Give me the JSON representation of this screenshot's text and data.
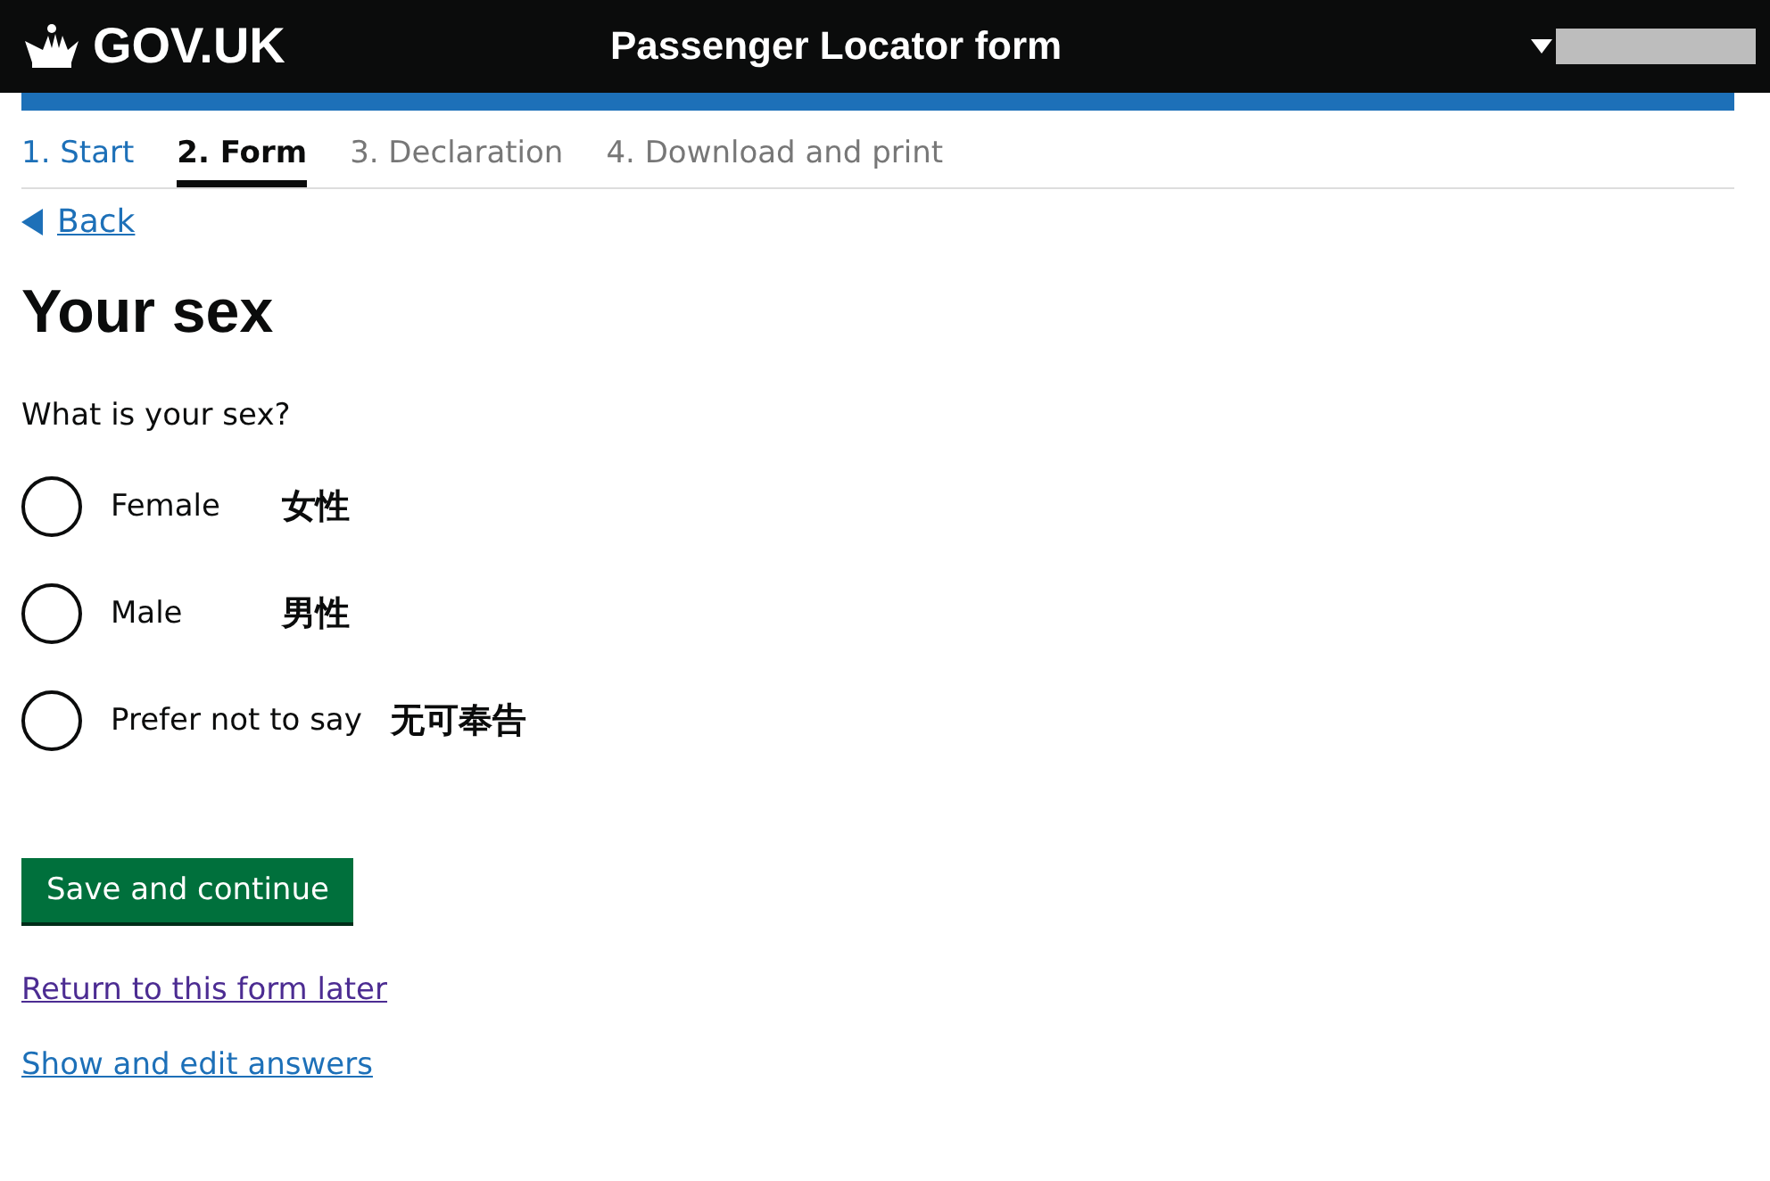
{
  "header": {
    "logo": "GOV.UK",
    "title": "Passenger Locator form"
  },
  "steps": [
    {
      "label": "1. Start",
      "kind": "done",
      "selected": false
    },
    {
      "label": "2. Form",
      "kind": "current",
      "selected": true
    },
    {
      "label": "3. Declaration",
      "kind": "todo",
      "selected": false
    },
    {
      "label": "4. Download and print",
      "kind": "todo",
      "selected": false
    }
  ],
  "back_link": "Back",
  "heading": "Your sex",
  "question": "What is your sex?",
  "options": [
    {
      "label": "Female",
      "note": "女性",
      "selected": false
    },
    {
      "label": "Male",
      "note": "男性",
      "selected": false
    },
    {
      "label": "Prefer not to say",
      "note": "无可奉告",
      "selected": false
    }
  ],
  "primary_button": "Save and continue",
  "links": [
    "Return to this form later",
    "Show and edit answers"
  ]
}
